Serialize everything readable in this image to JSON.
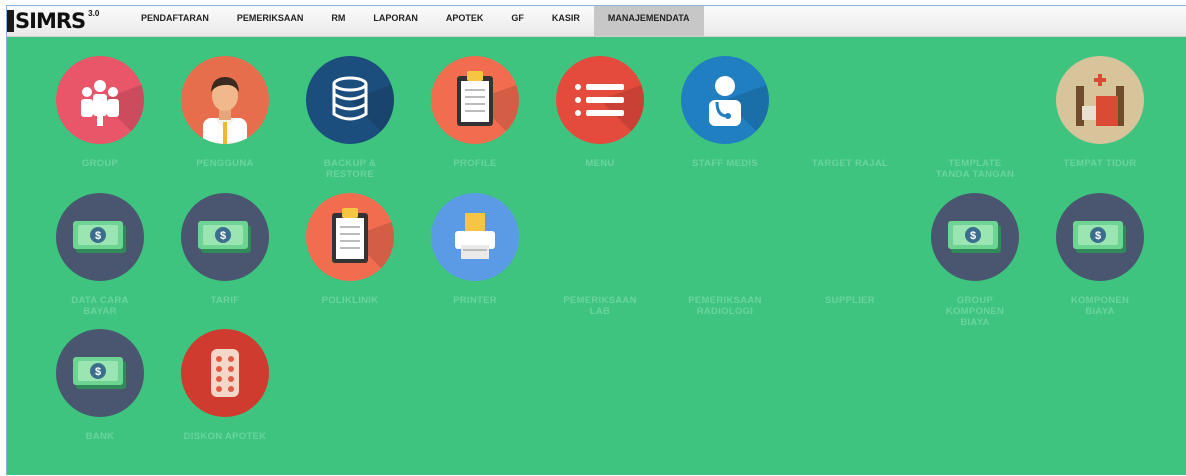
{
  "app": {
    "logo": "SIMRS",
    "version": "3.0"
  },
  "menu": [
    {
      "label": "PENDAFTARAN",
      "active": false
    },
    {
      "label": "PEMERIKSAAN",
      "active": false
    },
    {
      "label": "RM",
      "active": false
    },
    {
      "label": "LAPORAN",
      "active": false
    },
    {
      "label": "APOTEK",
      "active": false
    },
    {
      "label": "GF",
      "active": false
    },
    {
      "label": "KASIR",
      "active": false
    },
    {
      "label": "MANAJEMENDATA",
      "active": true
    }
  ],
  "tiles": [
    {
      "label": "GROUP",
      "icon": "group-icon",
      "color": "#e9566a"
    },
    {
      "label": "PENGGUNA",
      "icon": "user-icon",
      "color": "#e76e4c"
    },
    {
      "label": "BACKUP &\nRESTORE",
      "icon": "database-icon",
      "color": "#1c4e7d"
    },
    {
      "label": "PROFILE",
      "icon": "clipboard-icon",
      "color": "#f26c4f"
    },
    {
      "label": "MENU",
      "icon": "list-icon",
      "color": "#e44b3c"
    },
    {
      "label": "STAFF MEDIS",
      "icon": "doctor-icon",
      "color": "#1f7fc0"
    },
    {
      "label": "TARGET RAJAL",
      "icon": "",
      "color": ""
    },
    {
      "label": "TEMPLATE\nTANDA TANGAN",
      "icon": "",
      "color": ""
    },
    {
      "label": "TEMPAT TIDUR",
      "icon": "bed-icon",
      "color": "#d8c49a"
    },
    {
      "label": "DATA CARA\nBAYAR",
      "icon": "money-icon",
      "color": "#4a5670"
    },
    {
      "label": "TARIF",
      "icon": "money-icon",
      "color": "#4a5670"
    },
    {
      "label": "POLIKLINIK",
      "icon": "clipboard-icon",
      "color": "#f26c4f"
    },
    {
      "label": "PRINTER",
      "icon": "printer-icon",
      "color": "#5b9be6"
    },
    {
      "label": "PEMERIKSAAN\nLAB",
      "icon": "",
      "color": ""
    },
    {
      "label": "PEMERIKSAAN\nRADIOLOGI",
      "icon": "",
      "color": ""
    },
    {
      "label": "SUPPLIER",
      "icon": "",
      "color": ""
    },
    {
      "label": "GROUP\nKOMPONEN\nBIAYA",
      "icon": "money-icon",
      "color": "#4a5670"
    },
    {
      "label": "KOMPONEN\nBIAYA",
      "icon": "money-icon",
      "color": "#4a5670"
    },
    {
      "label": "BANK",
      "icon": "money-icon",
      "color": "#4a5670"
    },
    {
      "label": "DISKON APOTEK",
      "icon": "pills-icon",
      "color": "#cf3b2e"
    }
  ]
}
